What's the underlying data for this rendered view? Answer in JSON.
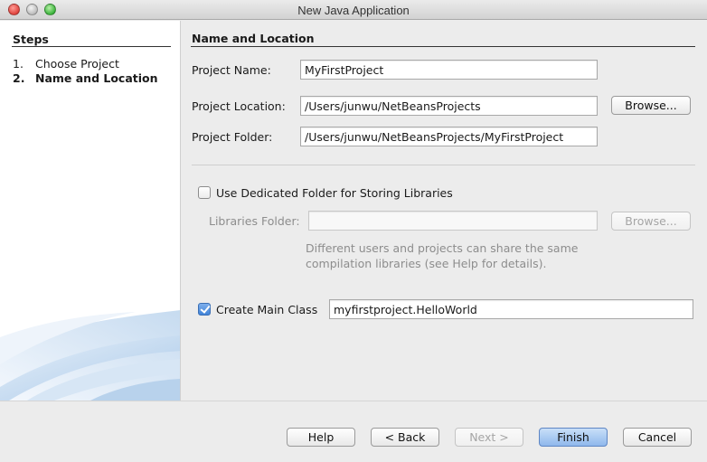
{
  "window": {
    "title": "New Java Application"
  },
  "steps": {
    "title": "Steps",
    "items": [
      {
        "num": "1.",
        "label": "Choose Project"
      },
      {
        "num": "2.",
        "label": "Name and Location"
      }
    ]
  },
  "main": {
    "section_title": "Name and Location",
    "project_name": {
      "label": "Project Name:",
      "value": "MyFirstProject"
    },
    "project_location": {
      "label": "Project Location:",
      "value": "/Users/junwu/NetBeansProjects",
      "browse": "Browse..."
    },
    "project_folder": {
      "label": "Project Folder:",
      "value": "/Users/junwu/NetBeansProjects/MyFirstProject"
    },
    "dedicated_folder": {
      "label": "Use Dedicated Folder for Storing Libraries",
      "checked": false,
      "libraries_label": "Libraries Folder:",
      "libraries_value": "",
      "browse": "Browse...",
      "note_line1": "Different users and projects can share the same",
      "note_line2": "compilation libraries (see Help for details)."
    },
    "main_class": {
      "label": "Create Main Class",
      "checked": true,
      "value": "myfirstproject.HelloWorld"
    }
  },
  "buttons": {
    "help": "Help",
    "back": "< Back",
    "next": "Next >",
    "finish": "Finish",
    "cancel": "Cancel"
  }
}
